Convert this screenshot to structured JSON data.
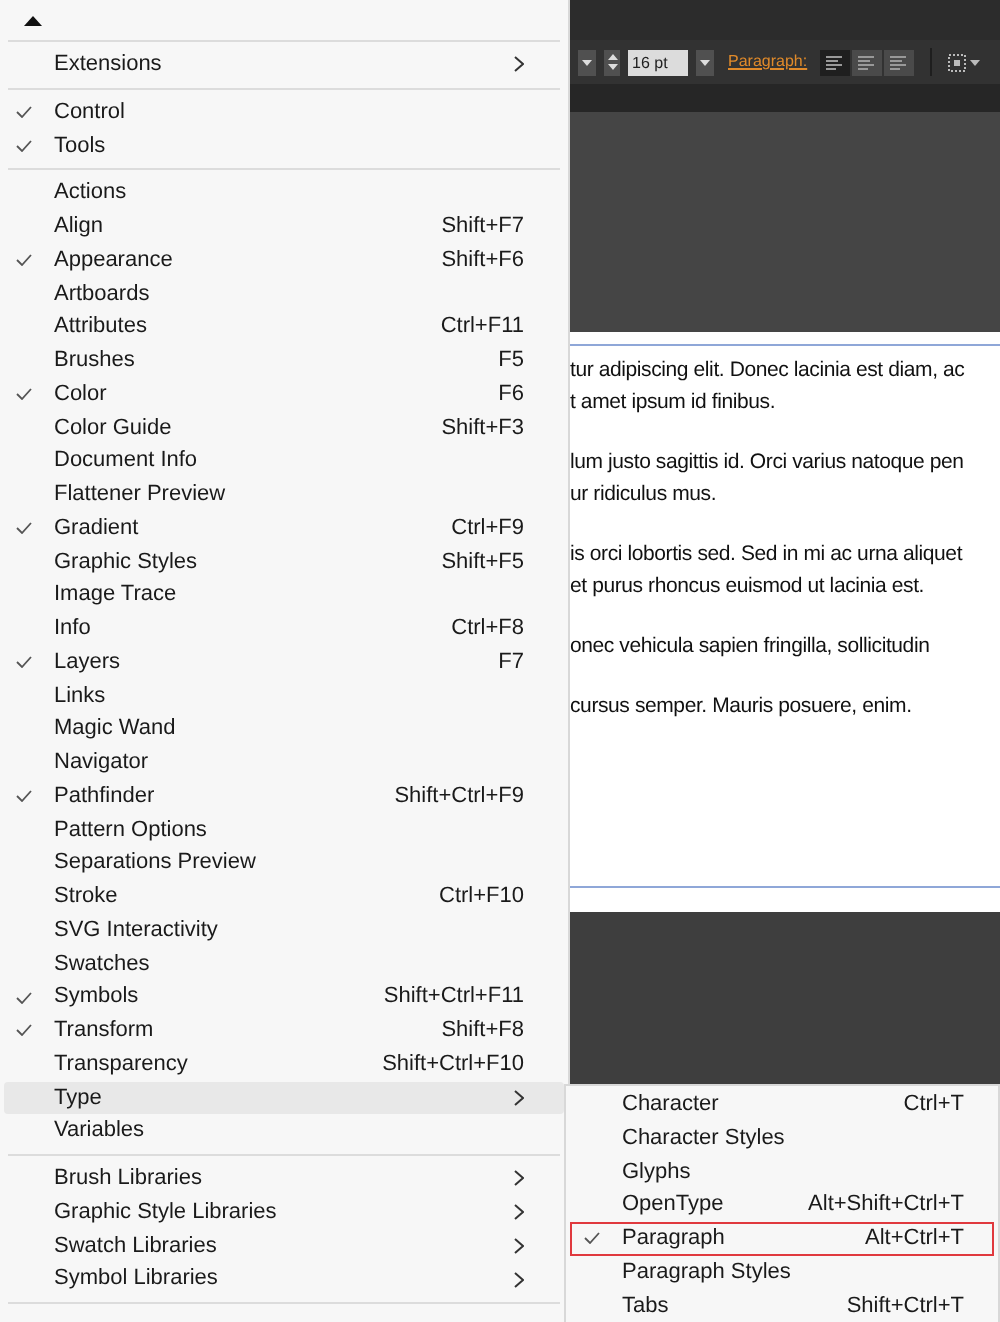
{
  "menu": {
    "sections": [
      [
        {
          "label": "Extensions",
          "checked": false,
          "selected": false,
          "submenu": true
        }
      ],
      [
        {
          "label": "Control",
          "checked": true,
          "selected": false,
          "submenu": false
        },
        {
          "label": "Tools",
          "checked": true,
          "selected": false,
          "submenu": false
        }
      ],
      [
        {
          "label": "Actions",
          "checked": false,
          "selected": false,
          "submenu": false
        },
        {
          "label": "Align",
          "shortcut": "Shift+F7",
          "checked": false,
          "selected": false,
          "submenu": false
        },
        {
          "label": "Appearance",
          "shortcut": "Shift+F6",
          "checked": true,
          "selected": false,
          "submenu": false
        },
        {
          "label": "Artboards",
          "checked": false,
          "selected": false,
          "submenu": false
        },
        {
          "label": "Attributes",
          "shortcut": "Ctrl+F11",
          "checked": false,
          "selected": false,
          "submenu": false
        },
        {
          "label": "Brushes",
          "shortcut": "F5",
          "checked": false,
          "selected": false,
          "submenu": false
        },
        {
          "label": "Color",
          "shortcut": "F6",
          "checked": true,
          "selected": false,
          "submenu": false
        },
        {
          "label": "Color Guide",
          "shortcut": "Shift+F3",
          "checked": false,
          "selected": false,
          "submenu": false
        },
        {
          "label": "Document Info",
          "checked": false,
          "selected": false,
          "submenu": false
        },
        {
          "label": "Flattener Preview",
          "checked": false,
          "selected": false,
          "submenu": false
        },
        {
          "label": "Gradient",
          "shortcut": "Ctrl+F9",
          "checked": true,
          "selected": false,
          "submenu": false
        },
        {
          "label": "Graphic Styles",
          "shortcut": "Shift+F5",
          "checked": false,
          "selected": false,
          "submenu": false
        },
        {
          "label": "Image Trace",
          "checked": false,
          "selected": false,
          "submenu": false
        },
        {
          "label": "Info",
          "shortcut": "Ctrl+F8",
          "checked": false,
          "selected": false,
          "submenu": false
        },
        {
          "label": "Layers",
          "shortcut": "F7",
          "checked": true,
          "selected": false,
          "submenu": false
        },
        {
          "label": "Links",
          "checked": false,
          "selected": false,
          "submenu": false
        },
        {
          "label": "Magic Wand",
          "checked": false,
          "selected": false,
          "submenu": false
        },
        {
          "label": "Navigator",
          "checked": false,
          "selected": false,
          "submenu": false
        },
        {
          "label": "Pathfinder",
          "shortcut": "Shift+Ctrl+F9",
          "checked": true,
          "selected": false,
          "submenu": false
        },
        {
          "label": "Pattern Options",
          "checked": false,
          "selected": false,
          "submenu": false
        },
        {
          "label": "Separations Preview",
          "checked": false,
          "selected": false,
          "submenu": false
        },
        {
          "label": "Stroke",
          "shortcut": "Ctrl+F10",
          "checked": false,
          "selected": false,
          "submenu": false
        },
        {
          "label": "SVG Interactivity",
          "checked": false,
          "selected": false,
          "submenu": false
        },
        {
          "label": "Swatches",
          "checked": false,
          "selected": false,
          "submenu": false
        },
        {
          "label": "Symbols",
          "shortcut": "Shift+Ctrl+F11",
          "checked": true,
          "selected": false,
          "submenu": false
        },
        {
          "label": "Transform",
          "shortcut": "Shift+F8",
          "checked": true,
          "selected": false,
          "submenu": false
        },
        {
          "label": "Transparency",
          "shortcut": "Shift+Ctrl+F10",
          "checked": false,
          "selected": false,
          "submenu": false
        },
        {
          "label": "Type",
          "checked": false,
          "selected": true,
          "submenu": true
        },
        {
          "label": "Variables",
          "checked": false,
          "selected": false,
          "submenu": false
        }
      ],
      [
        {
          "label": "Brush Libraries",
          "checked": false,
          "selected": false,
          "submenu": true
        },
        {
          "label": "Graphic Style Libraries",
          "checked": false,
          "selected": false,
          "submenu": true
        },
        {
          "label": "Swatch Libraries",
          "checked": false,
          "selected": false,
          "submenu": true
        },
        {
          "label": "Symbol Libraries",
          "checked": false,
          "selected": false,
          "submenu": true
        }
      ]
    ]
  },
  "submenu": {
    "items": [
      {
        "label": "Character",
        "shortcut": "Ctrl+T",
        "checked": false,
        "boxed": false
      },
      {
        "label": "Character Styles",
        "checked": false,
        "boxed": false
      },
      {
        "label": "Glyphs",
        "checked": false,
        "boxed": false
      },
      {
        "label": "OpenType",
        "shortcut": "Alt+Shift+Ctrl+T",
        "checked": false,
        "boxed": false
      },
      {
        "label": "Paragraph",
        "shortcut": "Alt+Ctrl+T",
        "checked": true,
        "boxed": true
      },
      {
        "label": "Paragraph Styles",
        "checked": false,
        "boxed": false
      },
      {
        "label": "Tabs",
        "shortcut": "Shift+Ctrl+T",
        "checked": false,
        "boxed": false
      }
    ]
  },
  "toolbar": {
    "font_size": "16 pt",
    "paragraph_link": "Paragraph:",
    "align_buttons": [
      {
        "selected": true
      },
      {
        "selected": false
      },
      {
        "selected": false
      }
    ]
  },
  "document": {
    "paragraphs": [
      [
        "tur adipiscing elit. Donec lacinia est diam, ac",
        "t amet ipsum id finibus."
      ],
      [
        "lum justo sagittis id. Orci varius natoque pen",
        "ur ridiculus mus."
      ],
      [
        "is orci lobortis sed. Sed in mi ac urna aliquet",
        "et purus rhoncus euismod ut lacinia est."
      ],
      [
        "onec vehicula sapien fringilla, sollicitudin"
      ],
      [
        "cursus semper. Mauris posuere, enim."
      ]
    ]
  }
}
